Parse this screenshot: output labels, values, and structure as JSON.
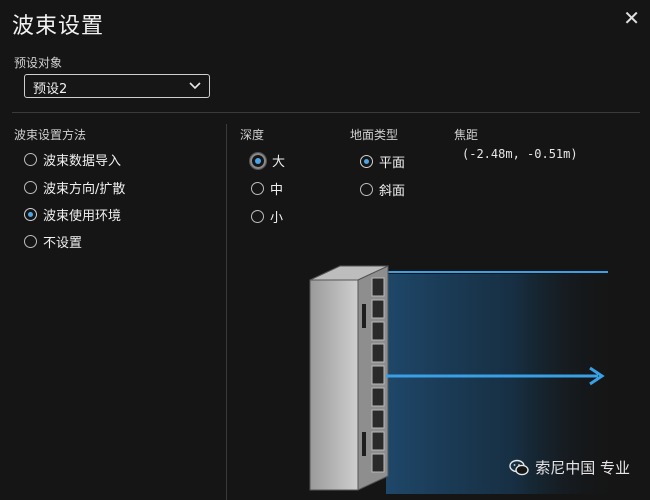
{
  "dialog": {
    "title": "波束设置",
    "close_glyph": "✕"
  },
  "preset": {
    "label": "预设对象",
    "selected": "预设2"
  },
  "method": {
    "label": "波束设置方法",
    "options": [
      "波束数据导入",
      "波束方向/扩散",
      "波束使用环境",
      "不设置"
    ],
    "selected_index": 2
  },
  "depth": {
    "label": "深度",
    "options": [
      "大",
      "中",
      "小"
    ],
    "selected_index": 0
  },
  "floor": {
    "label": "地面类型",
    "options": [
      "平面",
      "斜面"
    ],
    "selected_index": 0
  },
  "focus": {
    "label": "焦距",
    "value": "(-2.48m, -0.51m)"
  },
  "colors": {
    "accent": "#4aa6e8",
    "beam_line": "#3aa0e6",
    "background": "#151515"
  },
  "watermark": {
    "text": "索尼中国 专业",
    "icon": "wechat-icon"
  }
}
